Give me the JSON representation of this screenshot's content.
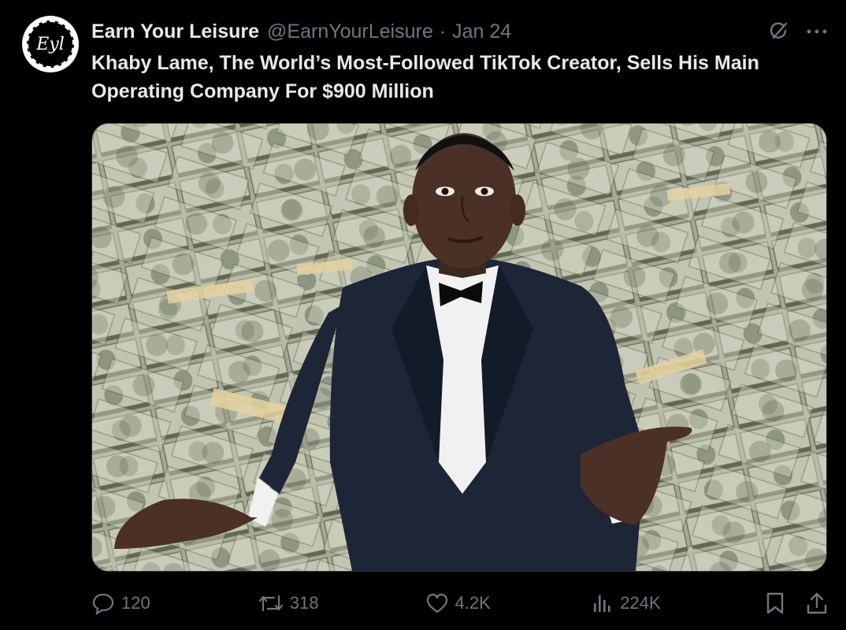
{
  "author": {
    "name": "Earn Your Leisure",
    "handle": "@EarnYourLeisure",
    "separator": "·",
    "date": "Jan 24",
    "avatar_text": "Eyl"
  },
  "post": {
    "text": "Khaby Lame, The World’s Most-Followed TikTok Creator, Sells His Main Operating Company For $900 Million"
  },
  "header_icons": [
    "grok-icon",
    "more-icon"
  ],
  "actions": {
    "replies": "120",
    "reposts": "318",
    "likes": "4.2K",
    "views": "224K"
  },
  "colors": {
    "background": "#000000",
    "text": "#e7e9ea",
    "muted": "#71767b"
  }
}
